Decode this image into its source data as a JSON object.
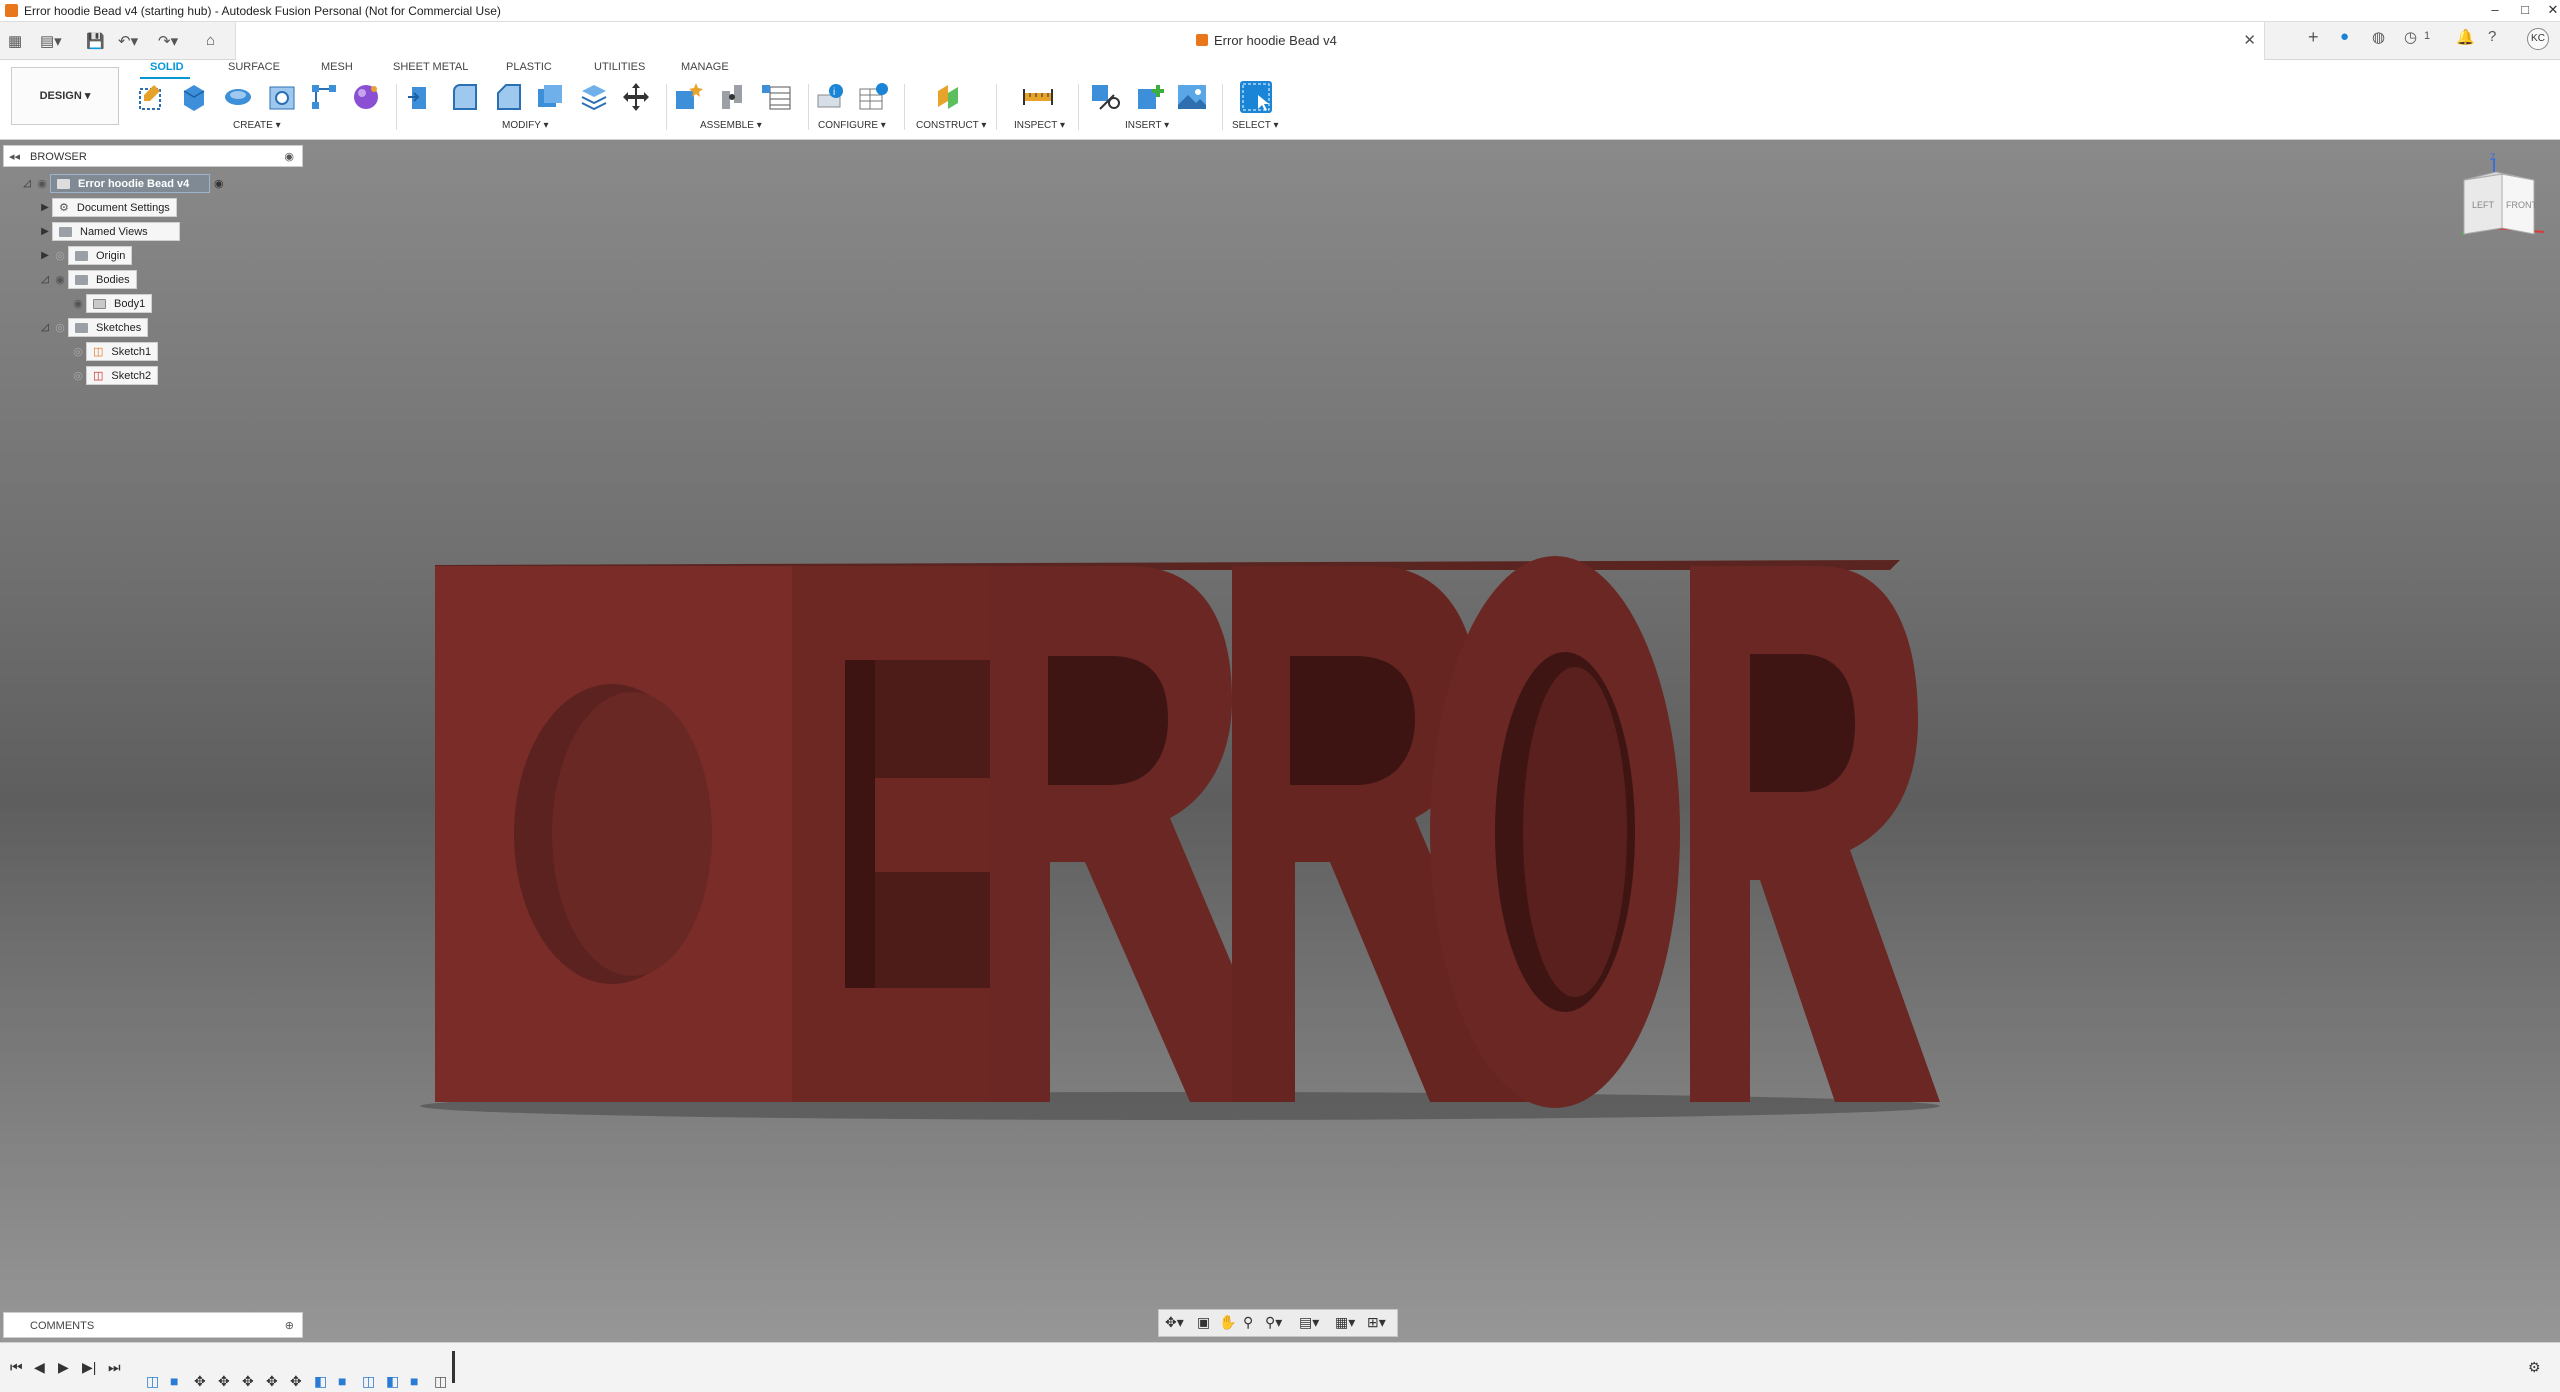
{
  "window": {
    "title": "Error hoodie Bead v4 (starting hub) - Autodesk Fusion Personal (Not for Commercial Use)",
    "controls": [
      "–",
      "□",
      "✕"
    ]
  },
  "document_tab": {
    "title": "Error hoodie Bead v4",
    "close": "✕"
  },
  "qat": {
    "icons": [
      "grid-icon",
      "file-icon",
      "save-icon",
      "undo-icon",
      "redo-icon",
      "home-icon"
    ],
    "glyphs": [
      "▦",
      "▤▾",
      "💾",
      "↶▾",
      "↷▾",
      "⌂"
    ]
  },
  "header_right": {
    "job_count": "1",
    "user_initials": "KC"
  },
  "ribbon": {
    "workspace": "DESIGN ▾",
    "tabs": [
      "SOLID",
      "SURFACE",
      "MESH",
      "SHEET METAL",
      "PLASTIC",
      "UTILITIES",
      "MANAGE"
    ],
    "active_tab": "SOLID",
    "groups": {
      "create": "CREATE ▾",
      "modify": "MODIFY ▾",
      "assemble": "ASSEMBLE ▾",
      "configure": "CONFIGURE ▾",
      "construct": "CONSTRUCT ▾",
      "inspect": "INSPECT ▾",
      "insert": "INSERT ▾",
      "select": "SELECT ▾"
    }
  },
  "browser": {
    "header": "BROWSER",
    "root": "Error hoodie Bead v4",
    "items": [
      {
        "label": "Document Settings"
      },
      {
        "label": "Named Views"
      },
      {
        "label": "Origin"
      },
      {
        "label": "Bodies"
      },
      {
        "label": "Body1"
      },
      {
        "label": "Sketches"
      },
      {
        "label": "Sketch1"
      },
      {
        "label": "Sketch2"
      }
    ]
  },
  "comments": {
    "header": "COMMENTS"
  },
  "viewcube": {
    "left": "LEFT",
    "front": "FRONT",
    "axis_z": "Z"
  },
  "model": {
    "text": "ERROR",
    "color": "#702a25"
  },
  "colors": {
    "accent": "#0696d7",
    "model": "#702a25",
    "model_face": "#7b2c28"
  }
}
